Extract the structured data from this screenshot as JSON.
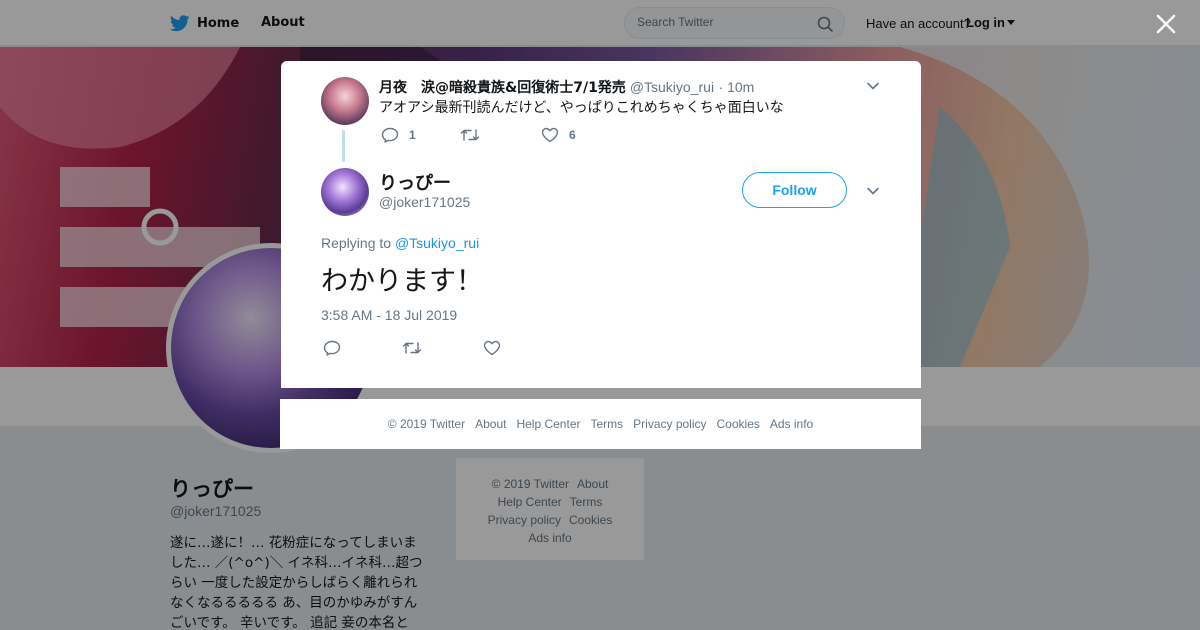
{
  "nav": {
    "home_label": "Home",
    "about_label": "About",
    "search_placeholder": "Search Twitter",
    "account_prompt": "Have an account?",
    "login_label": "Log in"
  },
  "profile": {
    "name": "りっぴー",
    "handle": "@joker171025",
    "bio": "遂に…遂に！… 花粉症になってしまいました… ／(^o^)＼ イネ科…イネ科…超つらい 一度した設定からしばらく離れられなくなるるるるる あ、目のかゆみがすんごいです。 辛いです。 追記 妾の本名と"
  },
  "side_footer": {
    "items": [
      "© 2019 Twitter",
      "About",
      "Help Center",
      "Terms",
      "Privacy policy",
      "Cookies",
      "Ads info"
    ]
  },
  "parent_tweet": {
    "name": "月夜　涙@暗殺貴族&回復術士7/1発売",
    "handle": "@Tsukiyo_rui",
    "time": "· 10m",
    "text": "アオアシ最新刊読んだけど、やっぱりこれめちゃくちゃ面白いな",
    "reply_count": "1",
    "like_count": "6"
  },
  "main_tweet": {
    "name": "りっぴー",
    "handle": "@joker171025",
    "follow_label": "Follow",
    "replying_prefix": "Replying to",
    "replying_to": "@Tsukiyo_rui",
    "text": "わかります！",
    "timestamp": "3:58 AM - 18 Jul 2019"
  },
  "modal_footer": {
    "items": [
      "© 2019 Twitter",
      "About",
      "Help Center",
      "Terms",
      "Privacy policy",
      "Cookies",
      "Ads info"
    ]
  },
  "icons": {
    "brand": "twitter-bird-icon",
    "search": "search-icon",
    "close": "close-icon",
    "more": "chevron-down-icon",
    "reply": "reply-icon",
    "retweet": "retweet-icon",
    "like": "heart-icon"
  },
  "colors": {
    "brand_blue": "#1da1f2",
    "link_blue": "#1b95e0",
    "text_primary": "#14171a",
    "text_secondary": "#657786",
    "thread_line": "#bcdcf2"
  }
}
